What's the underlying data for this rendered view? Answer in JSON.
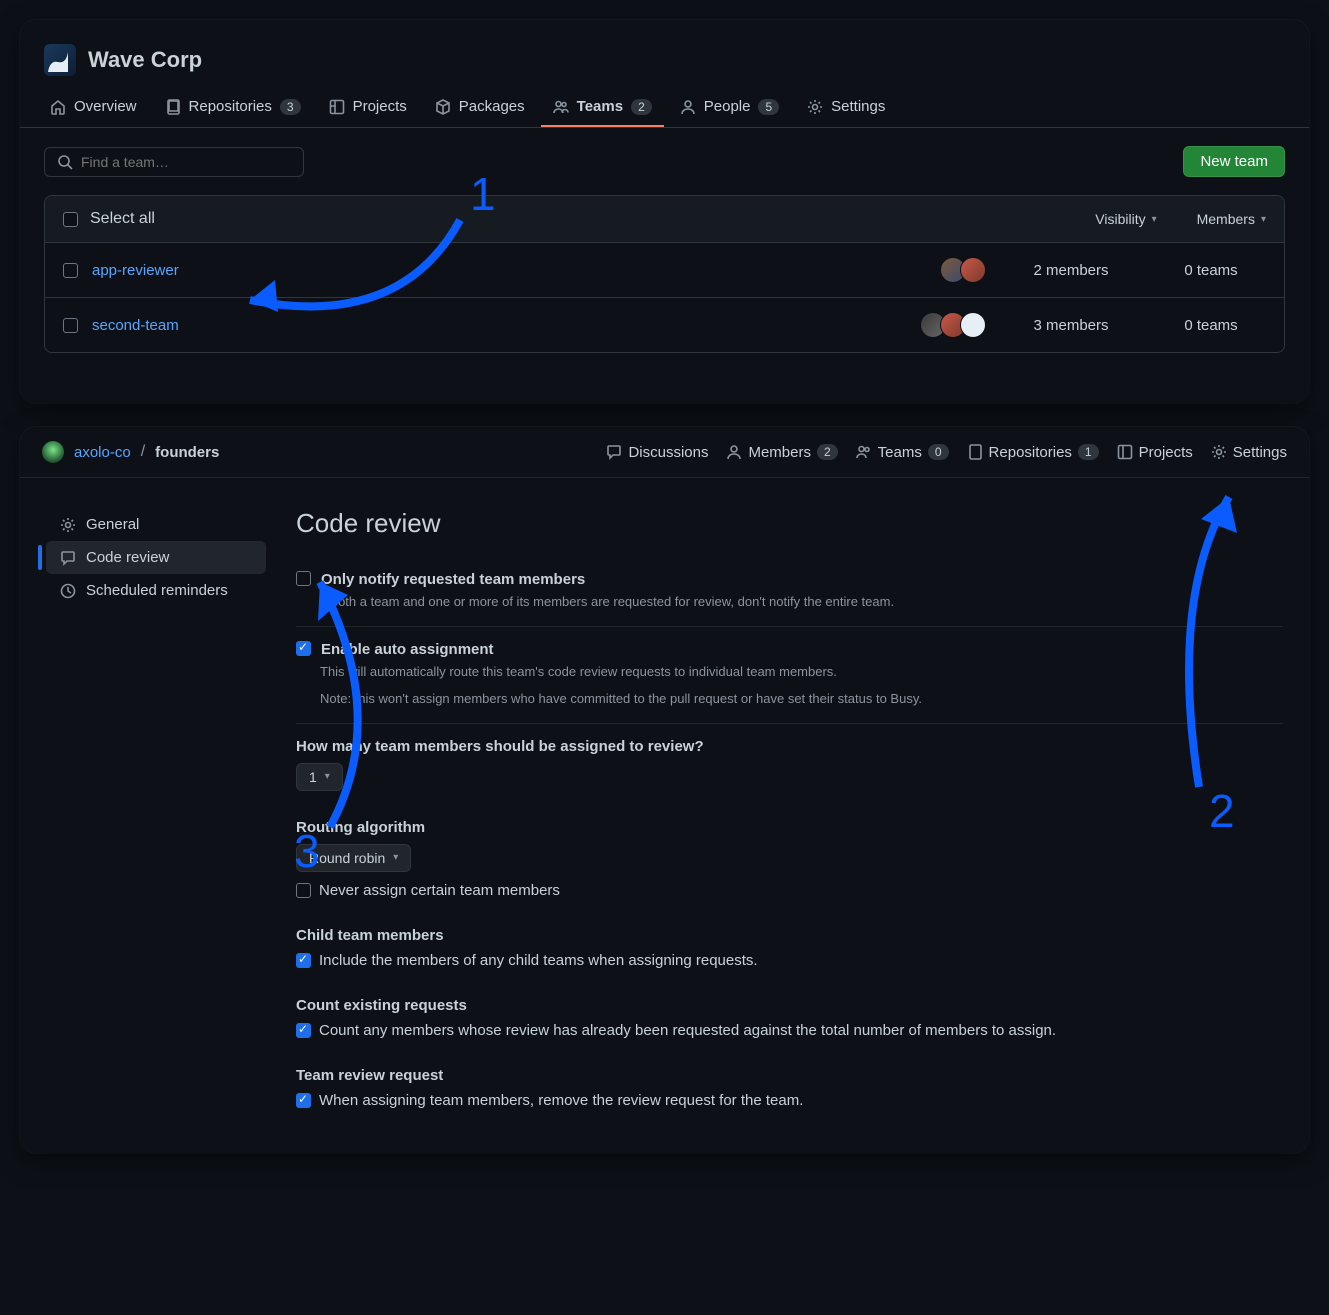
{
  "panel1": {
    "org_name": "Wave Corp",
    "tabs": {
      "overview": "Overview",
      "repositories": "Repositories",
      "repo_count": "3",
      "projects": "Projects",
      "packages": "Packages",
      "teams": "Teams",
      "teams_count": "2",
      "people": "People",
      "people_count": "5",
      "settings": "Settings"
    },
    "search_placeholder": "Find a team…",
    "new_team_btn": "New team",
    "select_all": "Select all",
    "col_visibility": "Visibility",
    "col_members": "Members",
    "rows": [
      {
        "name": "app-reviewer",
        "members": "2 members",
        "teams": "0 teams",
        "avatar_count": 2
      },
      {
        "name": "second-team",
        "members": "3 members",
        "teams": "0 teams",
        "avatar_count": 3
      }
    ]
  },
  "panel2": {
    "breadcrumb": {
      "org": "axolo-co",
      "team": "founders"
    },
    "tabs": {
      "discussions": "Discussions",
      "members": "Members",
      "members_count": "2",
      "teams": "Teams",
      "teams_count": "0",
      "repositories": "Repositories",
      "repo_count": "1",
      "projects": "Projects",
      "settings": "Settings"
    },
    "sidenav": {
      "general": "General",
      "code_review": "Code review",
      "scheduled": "Scheduled reminders"
    },
    "heading": "Code review",
    "only_notify": {
      "label": "Only notify requested team members",
      "desc": "If both a team and one or more of its members are requested for review, don't notify the entire team."
    },
    "auto_assign": {
      "label": "Enable auto assignment",
      "desc1": "This will automatically route this team's code review requests to individual team members.",
      "desc2": "Note: this won't assign members who have committed to the pull request or have set their status to Busy."
    },
    "how_many": {
      "label": "How many team members should be assigned to review?",
      "value": "1"
    },
    "routing": {
      "label": "Routing algorithm",
      "value": "Round robin",
      "never": "Never assign certain team members"
    },
    "child": {
      "label": "Child team members",
      "desc": "Include the members of any child teams when assigning requests."
    },
    "existing": {
      "label": "Count existing requests",
      "desc": "Count any members whose review has already been requested against the total number of members to assign."
    },
    "team_review": {
      "label": "Team review request",
      "desc": "When assigning team members, remove the review request for the team."
    }
  },
  "annotations": {
    "n1": "1",
    "n2": "2",
    "n3": "3"
  }
}
